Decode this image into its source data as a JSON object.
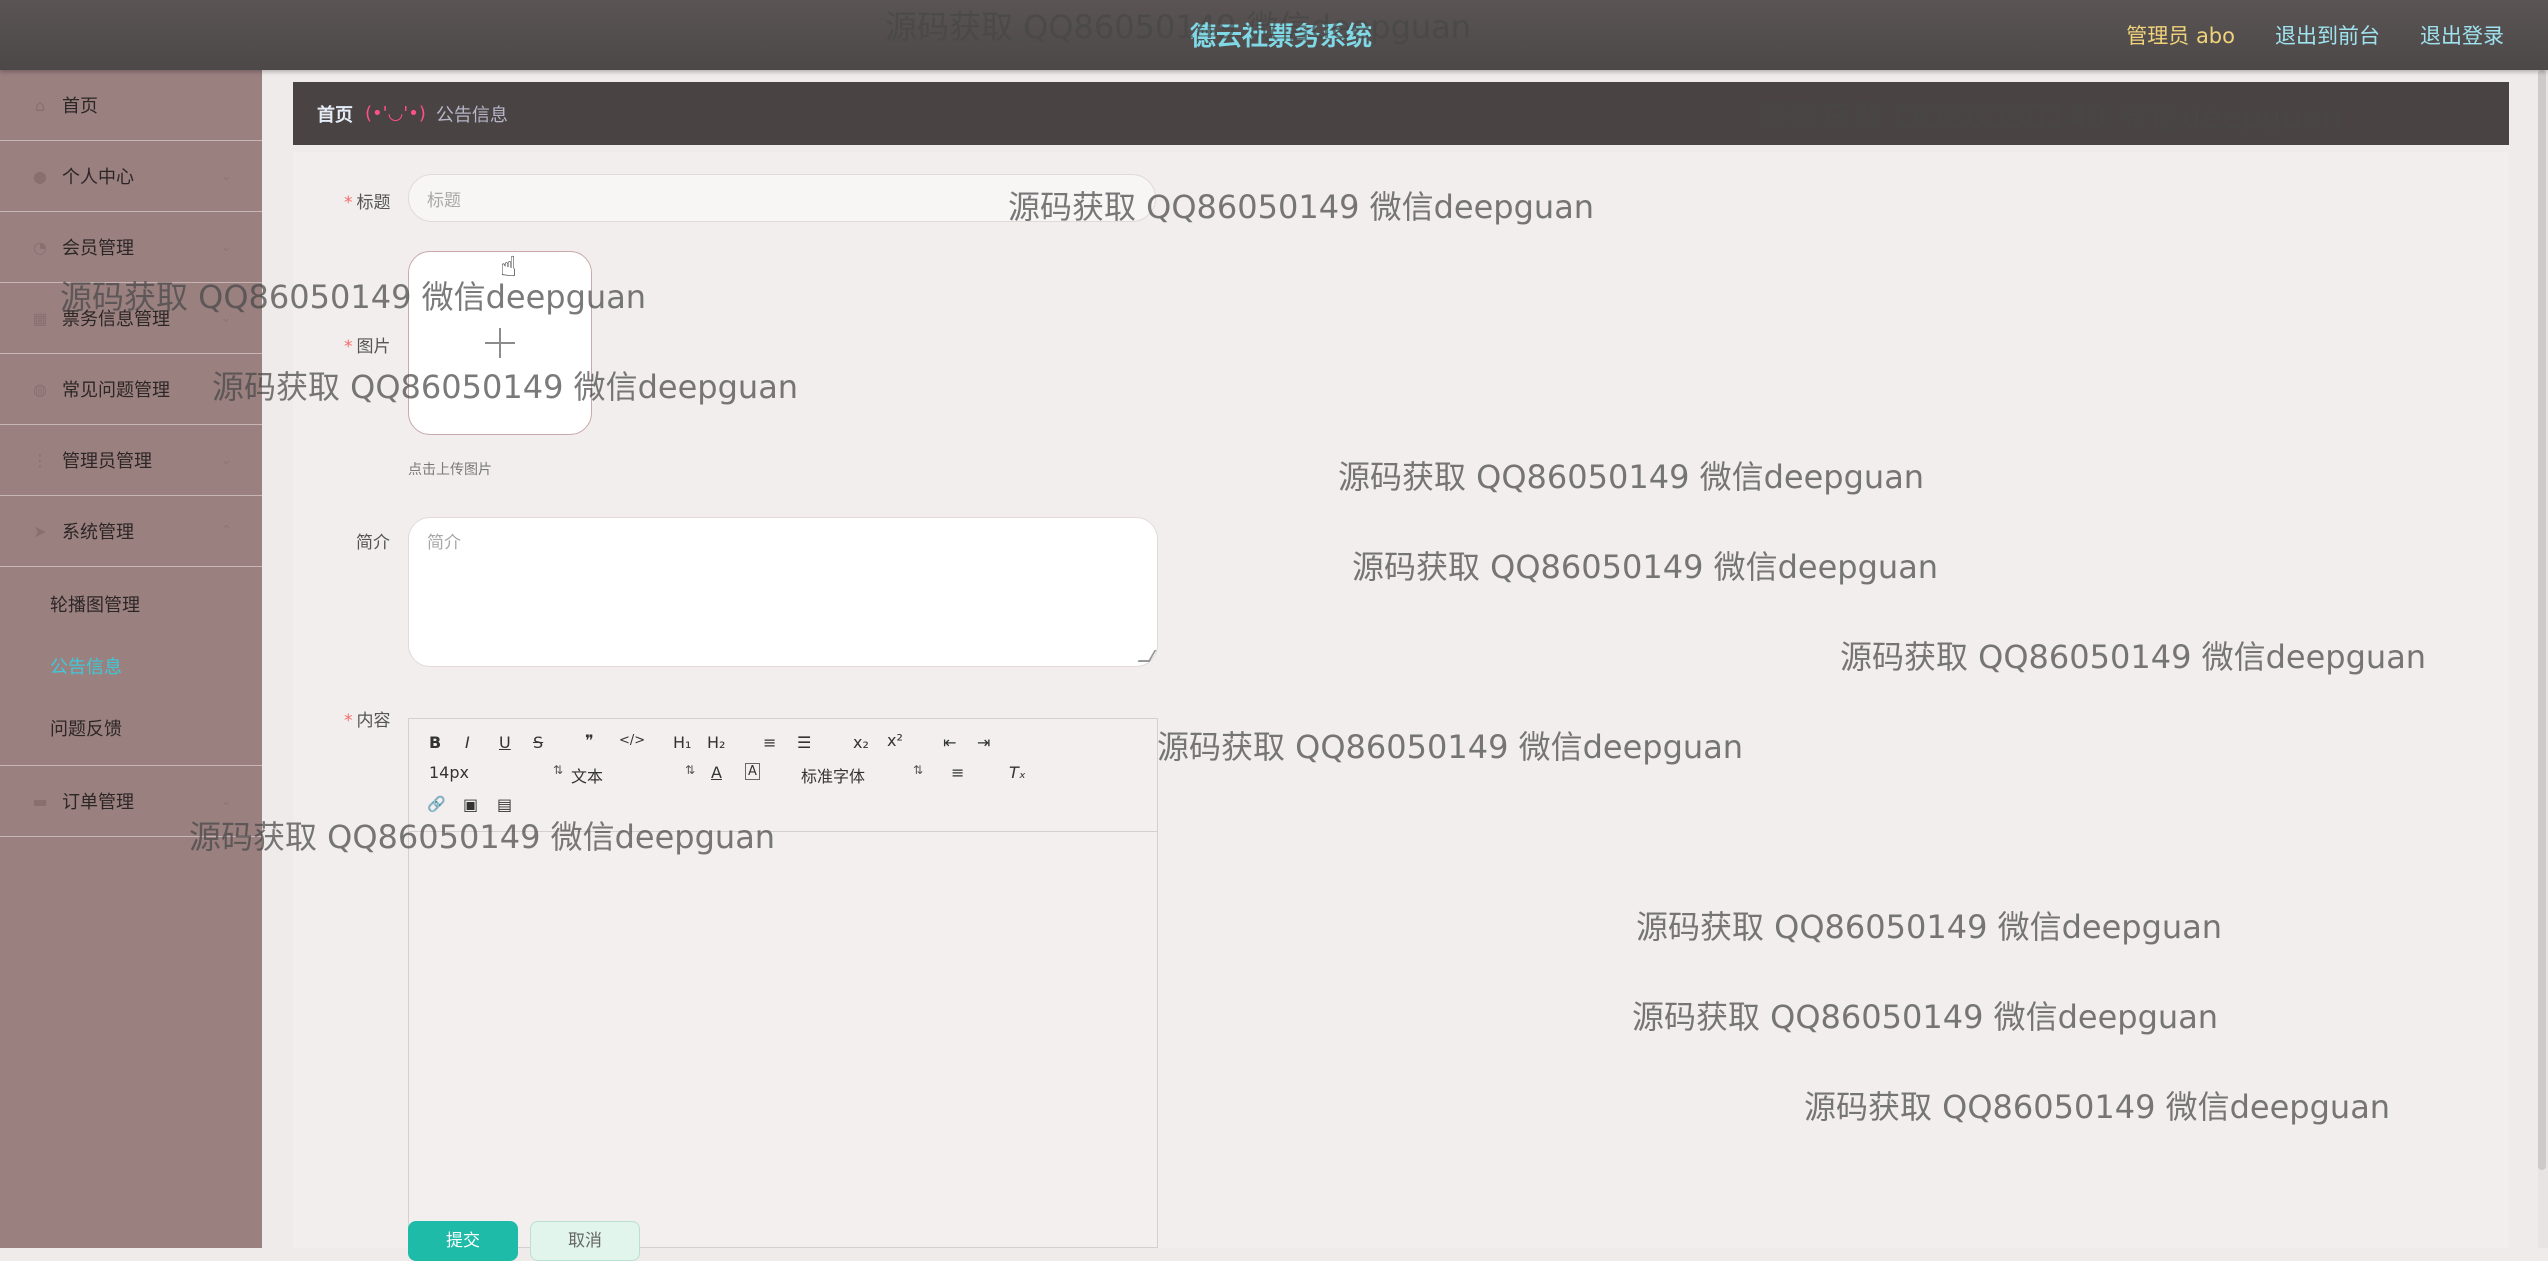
{
  "header": {
    "title": "德云社票务系统",
    "user_label": "管理员 abo",
    "to_front_label": "退出到前台",
    "logout_label": "退出登录"
  },
  "sidebar": {
    "items": [
      {
        "label": "首页",
        "icon": "home-icon"
      },
      {
        "label": "个人中心",
        "icon": "user-icon"
      },
      {
        "label": "会员管理",
        "icon": "members-icon"
      },
      {
        "label": "票务信息管理",
        "icon": "ticket-icon"
      },
      {
        "label": "常见问题管理",
        "icon": "question-icon"
      },
      {
        "label": "管理员管理",
        "icon": "admin-icon"
      },
      {
        "label": "系统管理",
        "icon": "system-icon"
      }
    ],
    "system_sub": [
      "轮播图管理",
      "公告信息",
      "问题反馈"
    ],
    "last_item": {
      "label": "订单管理",
      "icon": "order-icon"
    }
  },
  "breadcrumb": {
    "home": "首页",
    "face": "(•'◡'•)",
    "current": "公告信息"
  },
  "form": {
    "title_label": "标题",
    "title_placeholder": "标题",
    "image_label": "图片",
    "upload_tip": "点击上传图片",
    "intro_label": "简介",
    "intro_placeholder": "简介",
    "content_label": "内容",
    "submit_label": "提交",
    "cancel_label": "取消"
  },
  "editor": {
    "font_size": "14px",
    "header_select": "文本",
    "font_family": "标准字体",
    "buttons": {
      "bold": "B",
      "italic": "I",
      "underline": "U",
      "strike": "S",
      "quote": "❞",
      "code": "</>",
      "h1": "H₁",
      "h2": "H₂",
      "ol": "≡",
      "ul": "☰",
      "sub": "x₂",
      "sup": "x²",
      "outdent": "⇤",
      "indent": "⇥",
      "color": "A",
      "background": "A",
      "align": "≡",
      "clean": "Tₓ",
      "link": "🔗",
      "image": "▣",
      "video": "▤"
    }
  },
  "watermark": "源码获取 QQ86050149 微信deepguan",
  "colors": {
    "header_bg": "#4d4848",
    "sidebar_bg": "#9b8080",
    "active_text": "#3fc8d8",
    "submit_bg": "#1fbba9"
  }
}
